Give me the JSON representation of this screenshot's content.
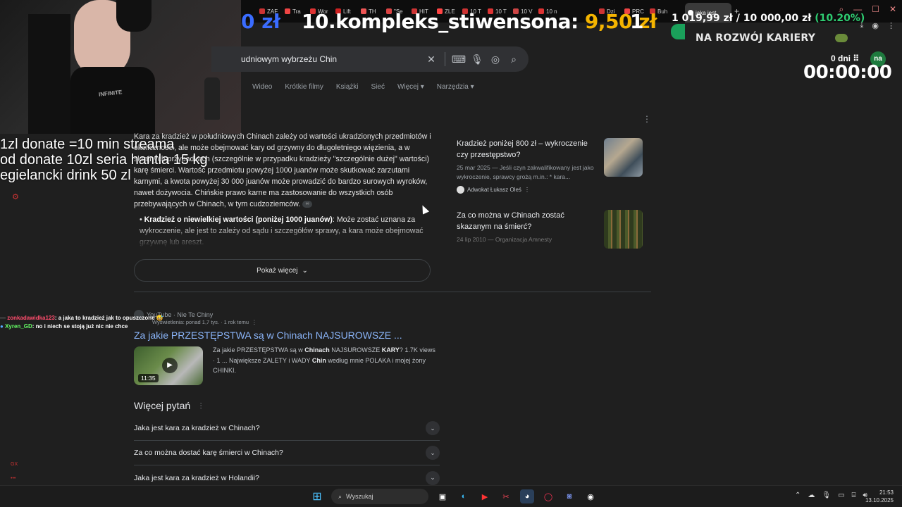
{
  "browser": {
    "tabs": [
      "ZAF",
      "Tra",
      "Wor",
      "Lift",
      "TH",
      "\"Se",
      "HIT",
      "ZLE",
      "10 T",
      "10 T",
      "10 V",
      "10 n",
      "Dzi",
      "PRC",
      "Buh"
    ],
    "active_tab": "jaka jest",
    "tab_colors": [
      "#c33",
      "#e44",
      "#d33",
      "#c22",
      "#e55",
      "#d44",
      "#c33",
      "#f44",
      "#c33",
      "#d33",
      "#c44",
      "#d33",
      "#c33",
      "#e44",
      "#c33"
    ]
  },
  "donation_goal": {
    "currency_prefix": "0 zł",
    "title": "10.kompleks_stiwensona:",
    "price": "9,50 zł",
    "count": "1",
    "progress": "1 019,99 zł / 10 000,00 zł",
    "percent": "(10.20%)",
    "percent_value": 0.102
  },
  "search": {
    "query": "udniowym wybrzeżu Chin",
    "nav_tabs": [
      "Wideo",
      "Krótkie filmy",
      "Książki",
      "Sieć",
      "Więcej ▾",
      "Narzędzia ▾"
    ]
  },
  "ai_overview": {
    "paragraph": "Kara za kradzież w południowych Chinach zależy od wartości ukradzionych przedmiotów i okoliczności, ale może obejmować kary od grzywny do długoletniego więzienia, a w skrajnych przypadkach (szczególnie w przypadku kradzieży \"szczególnie dużej\" wartości) karę śmierci. Wartość przedmiotu powyżej 1000 juanów może skutkować zarzutami karnymi, a kwota powyżej 30 000 juanów może prowadzić do bardzo surowych wyroków, nawet dożywocia. Chińskie prawo karne ma zastosowanie do wszystkich osób przebywających w Chinach, w tym cudzoziemców.",
    "bullet_bold": "Kradzież o niewielkiej wartości (poniżej 1000 juanów)",
    "bullet_text": ": Może zostać uznana za wykroczenie, ale jest to zależy od sądu i szczegółów sprawy, a kara może obejmować grzywnę lub areszt.",
    "show_more": "Pokaż więcej"
  },
  "cards": [
    {
      "title": "Kradzież poniżej 800 zł – wykroczenie czy przestępstwo?",
      "desc": "25 mar 2025 — Jeśli czyn zakwalifikowany jest jako wykroczenie, sprawcy grożą m.in.: * kara...",
      "source": "Adwokat Łukasz Oleś"
    },
    {
      "title": "Za co można w Chinach zostać skazanym na śmierć?",
      "desc": "24 lip 2010 — Organizacja Amnesty",
      "source": ""
    }
  ],
  "youtube": {
    "source": "YouTube · Nie Te Chiny",
    "meta": "Wyświetlenia: ponad 1,7 tys. · 1 rok temu",
    "title": "Za jakie PRZESTĘPSTWA są w Chinach NAJSUROWSZE ...",
    "duration": "11:35",
    "desc_plain_1": "Za jakie PRZESTĘPSTWA są w ",
    "desc_bold_1": "Chinach",
    "desc_plain_2": " NAJSUROWSZE ",
    "desc_bold_2": "KARY",
    "desc_plain_3": "? 1.7K views · 1 ... Największe ZALETY i WADY ",
    "desc_bold_3": "Chin",
    "desc_plain_4": " według mnie POLAKA i mojej żony CHINKI."
  },
  "related_questions": {
    "heading": "Więcej pytań",
    "items": [
      "Jaka jest kara za kradzież w Chinach?",
      "Za co można dostać karę śmierci w Chinach?",
      "Jaka jest kara za kradzież w Holandii?"
    ]
  },
  "stream_overlay": {
    "rules": [
      "1zl donate =10 min streama",
      "od donate 10zl seria hantla 15 kg",
      "egielancki drink 50 zl"
    ],
    "shirt_text": "INFINITE",
    "chat": [
      {
        "user": "zonkadawidka123",
        "message": ": a jaka to kradzież jak to opuszczone"
      },
      {
        "user": "Xyren_GD",
        "message": ": no i niech se stoją już nic nie chce"
      }
    ],
    "career_text": "NA ROZWÓJ KARIERY",
    "days_text": "0 dni",
    "avatar_text": "na",
    "timer": "00:00:00"
  },
  "taskbar": {
    "search_placeholder": "Wyszukaj",
    "time": "21:53",
    "date": "13.10.2025"
  }
}
